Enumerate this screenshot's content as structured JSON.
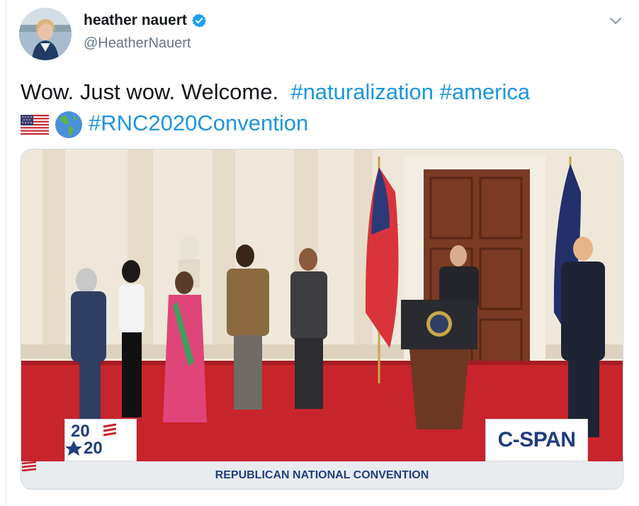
{
  "user": {
    "display_name": "heather nauert",
    "handle": "@HeatherNauert"
  },
  "tweet": {
    "text_lead": "Wow. Just wow. Welcome.",
    "hashtags": [
      "#naturalization",
      "#america",
      "#RNC2020Convention"
    ],
    "emoji": [
      "us-flag-icon",
      "globe-americas-icon"
    ]
  },
  "media": {
    "logo_2020_top": "20",
    "logo_2020_bottom": "20",
    "network_label": "C-SPAN",
    "banner_text": "REPUBLICAN NATIONAL CONVENTION"
  },
  "colors": {
    "hashtag": "#1b95e0",
    "verified": "#1da1f2",
    "cspan_blue": "#1f3e7d",
    "carpet_red": "#c8242b"
  }
}
